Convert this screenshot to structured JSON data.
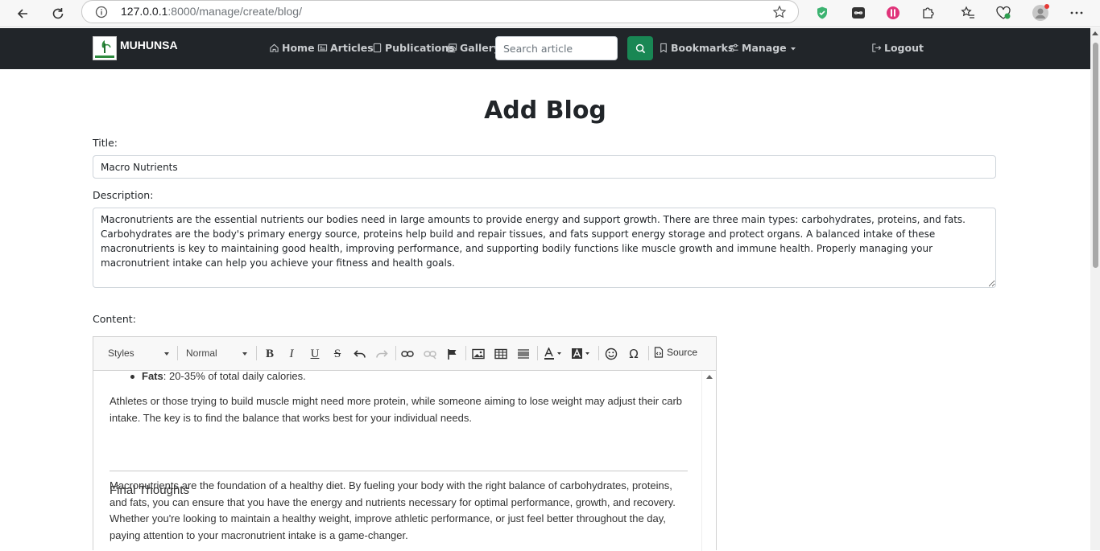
{
  "browser": {
    "url_host": "127.0.0.1",
    "url_rest": ":8000/manage/create/blog/"
  },
  "navbar": {
    "brand": "MUHUNSA",
    "links": {
      "home": "Home",
      "articles": "Articles",
      "publications": "Publications",
      "gallery": "Gallery",
      "bookmarks": "Bookmarks",
      "manage": "Manage",
      "logout": "Logout"
    },
    "search_placeholder": "Search article",
    "accent_color": "#198754"
  },
  "form": {
    "heading": "Add Blog",
    "title_label": "Title:",
    "title_value": "Macro Nutrients",
    "description_label": "Description:",
    "description_value": "Macronutrients are the essential nutrients our bodies need in large amounts to provide energy and support growth. There are three main types: carbohydrates, proteins, and fats. Carbohydrates are the body's primary energy source, proteins help build and repair tissues, and fats support energy storage and protect organs. A balanced intake of these macronutrients is key to maintaining good health, improving performance, and supporting bodily functions like muscle growth and immune health. Properly managing your macronutrient intake can help you achieve your fitness and health goals.",
    "content_label": "Content:"
  },
  "editor": {
    "toolbar": {
      "styles": "Styles",
      "format": "Normal",
      "source": "Source",
      "buttons": [
        "bold-icon",
        "italic-icon",
        "underline-icon",
        "strikethrough-icon",
        "undo-icon",
        "redo-icon",
        "link-icon",
        "unlink-icon",
        "anchor-icon",
        "image-icon",
        "table-icon",
        "horizontal-line-icon",
        "text-color-icon",
        "background-color-icon",
        "smiley-icon",
        "special-char-icon",
        "source-icon"
      ]
    },
    "content": {
      "bullet_label": "Fats",
      "bullet_text": ": 20-35% of total daily calories.",
      "para1": "Athletes or those trying to build muscle might need more protein, while someone aiming to lose weight may adjust their carb intake. The key is to find the balance that works best for your individual needs.",
      "heading": "Final Thoughts",
      "para2": "Macronutrients are the foundation of a healthy diet. By fueling your body with the right balance of carbohydrates, proteins, and fats, you can ensure that you have the energy and nutrients necessary for optimal performance, growth, and recovery. Whether you're looking to maintain a healthy weight, improve athletic performance, or just feel better throughout the day, paying attention to your macronutrient intake is a game-changer."
    }
  }
}
